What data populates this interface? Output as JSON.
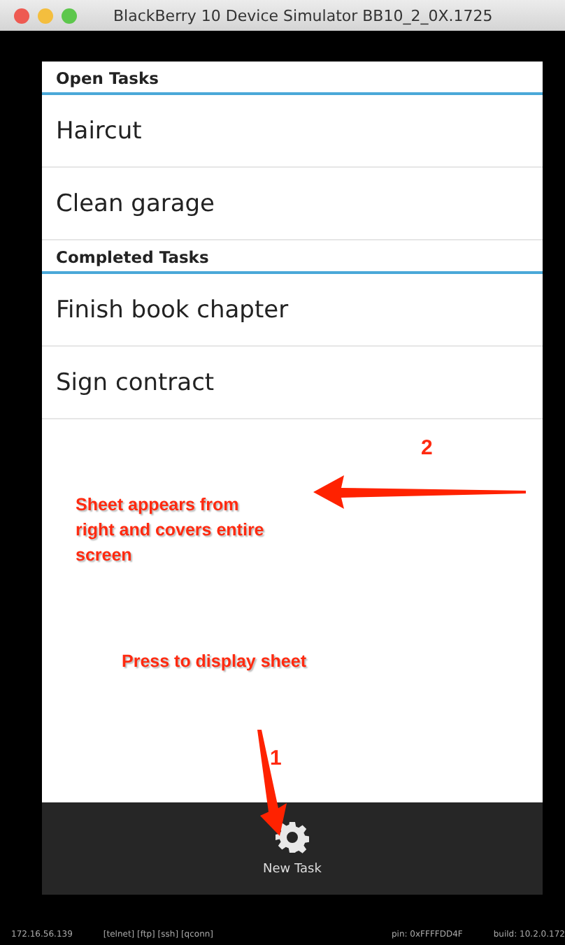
{
  "window": {
    "title": "BlackBerry 10 Device Simulator BB10_2_0X.1725"
  },
  "sections": [
    {
      "header": "Open Tasks",
      "items": [
        "Haircut",
        "Clean garage"
      ]
    },
    {
      "header": "Completed Tasks",
      "items": [
        "Finish book chapter",
        "Sign contract"
      ]
    }
  ],
  "action_bar": {
    "label": "New Task"
  },
  "annotations": [
    {
      "kind": "left",
      "text": "Sheet appears from right and covers entire screen",
      "number": "2"
    },
    {
      "kind": "down",
      "text": "Press to display sheet",
      "number": "1"
    }
  ],
  "status_bar": {
    "ip": "172.16.56.139",
    "services": "[telnet] [ftp] [ssh] [qconn]",
    "pin": "pin: 0xFFFFDD4F",
    "build": "build: 10.2.0.172"
  }
}
